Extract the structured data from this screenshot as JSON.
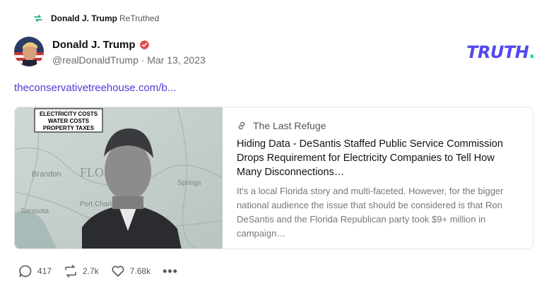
{
  "retruth": {
    "name": "Donald J. Trump",
    "suffix": "ReTruthed"
  },
  "author": {
    "name": "Donald J. Trump",
    "meta": "@realDonaldTrump · Mar 13, 2023"
  },
  "brand": {
    "word": "TRUTH",
    "dot": "."
  },
  "post": {
    "link_text": "theconservativetreehouse.com/b..."
  },
  "card": {
    "image_caption_lines": [
      "ELECTRICITY COSTS",
      "WATER COSTS",
      "PROPERTY TAXES"
    ],
    "source": "The Last Refuge",
    "title": "Hiding Data - DeSantis Staffed Public Service Commission Drops Requirement for Electricity Companies to Tell How Many Disconnections…",
    "description": "It's a local Florida story and multi-faceted. However, for the bigger national audience the issue that should be considered is that Ron DeSantis and the Florida Republican party took $9+ million in campaign…"
  },
  "actions": {
    "replies": "417",
    "retruths": "2.7k",
    "likes": "7.68k",
    "more": "•••"
  },
  "colors": {
    "brand": "#5448ee",
    "brand_dot": "#0fd8b0",
    "link": "#4a3fd8",
    "verified": "#e64a4a",
    "retruth_icon": "#20b37a"
  }
}
